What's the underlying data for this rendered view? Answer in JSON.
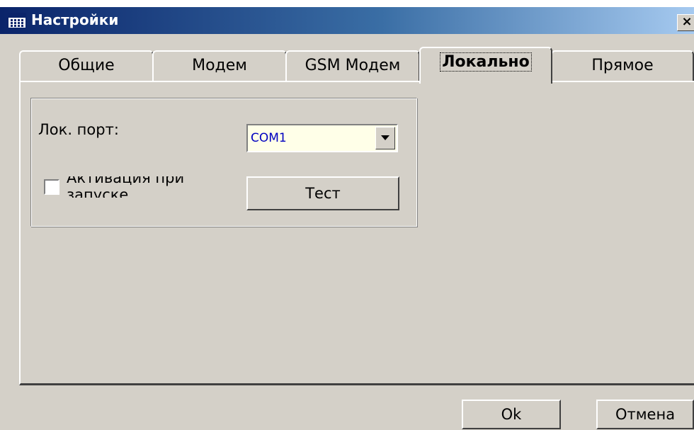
{
  "window": {
    "title": "Настройки",
    "close_label": "×"
  },
  "tabs": [
    {
      "label": "Общие",
      "active": false
    },
    {
      "label": "Модем",
      "active": false
    },
    {
      "label": "GSM Модем",
      "active": false
    },
    {
      "label": "Локально",
      "active": true
    },
    {
      "label": "Прямое",
      "active": false
    }
  ],
  "local": {
    "port_label": "Лок. порт:",
    "port_value": "COM1",
    "activate_label": "Активация при запуске",
    "activate_checked": false,
    "test_button": "Тест"
  },
  "footer": {
    "ok_label": "Ok",
    "cancel_label": "Отмена"
  },
  "colors": {
    "face": "#d4d0c8",
    "titlebar_start": "#0a246a",
    "titlebar_end": "#a6caf0",
    "combo_background": "#ffffe8",
    "combo_text": "#0000c0"
  },
  "icons": {
    "window": "calculator-icon",
    "close": "close-icon",
    "dropdown": "chevron-down-icon"
  }
}
